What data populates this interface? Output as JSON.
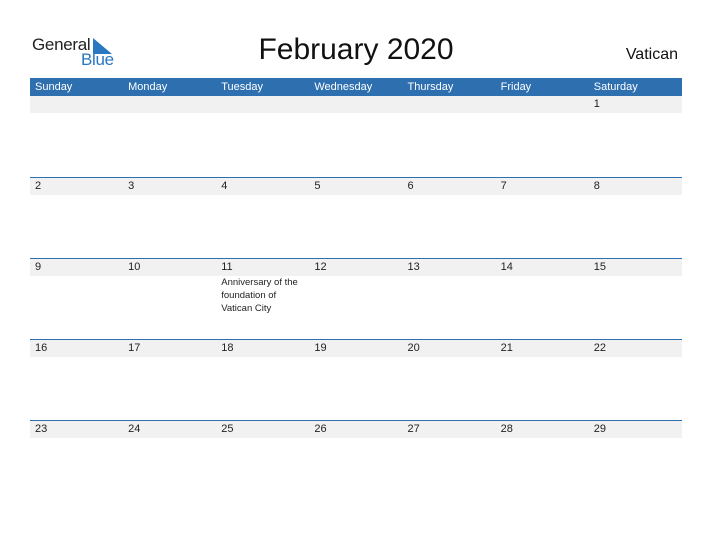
{
  "logo": {
    "word1": "General",
    "word2": "Blue"
  },
  "title": "February 2020",
  "country": "Vatican",
  "colors": {
    "accent": "#2e6fb0",
    "strip": "#f1f1f1"
  },
  "weekdays": [
    "Sunday",
    "Monday",
    "Tuesday",
    "Wednesday",
    "Thursday",
    "Friday",
    "Saturday"
  ],
  "weeks": [
    [
      "",
      "",
      "",
      "",
      "",
      "",
      "1"
    ],
    [
      "2",
      "3",
      "4",
      "5",
      "6",
      "7",
      "8"
    ],
    [
      "9",
      "10",
      "11",
      "12",
      "13",
      "14",
      "15"
    ],
    [
      "16",
      "17",
      "18",
      "19",
      "20",
      "21",
      "22"
    ],
    [
      "23",
      "24",
      "25",
      "26",
      "27",
      "28",
      "29"
    ]
  ],
  "events": [
    {
      "week": 2,
      "day": 2,
      "label": "Anniversary of the foundation of Vatican City"
    }
  ]
}
